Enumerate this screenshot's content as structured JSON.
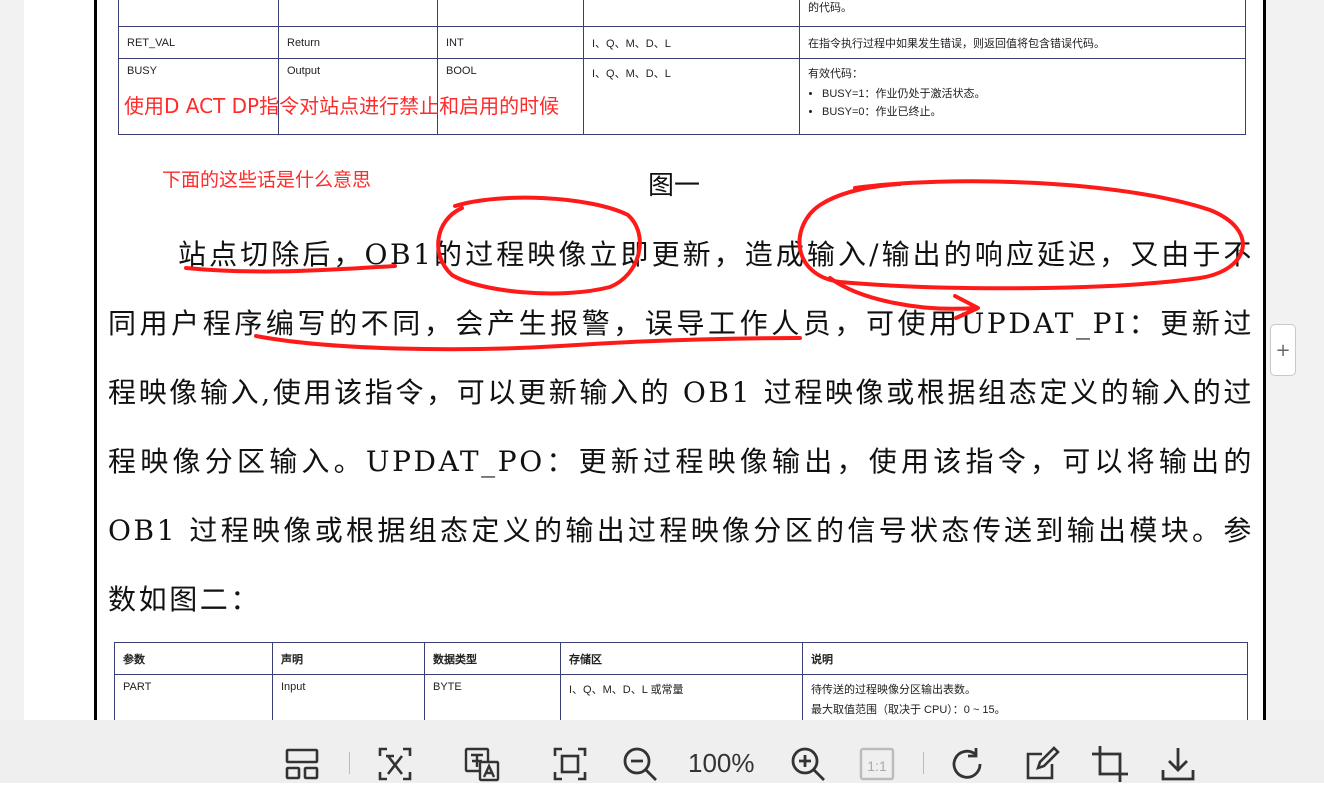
{
  "table_top": {
    "row0_desc": "的代码。",
    "rows": [
      {
        "param": "RET_VAL",
        "decl": "Return",
        "type": "INT",
        "area": "I、Q、M、D、L",
        "desc": "在指令执行过程中如果发生错误，则返回值将包含错误代码。"
      },
      {
        "param": "BUSY",
        "decl": "Output",
        "type": "BOOL",
        "area": "I、Q、M、D、L",
        "desc_title": "有效代码：",
        "desc_items": [
          "BUSY=1：作业仍处于激活状态。",
          "BUSY=0：作业已终止。"
        ]
      }
    ]
  },
  "annotations": {
    "note1": "使用D ACT DP指令对站点进行禁止和启用的时候",
    "note2": "下面的这些话是什么意思"
  },
  "figure_caption": "图一",
  "body_paragraph": "站点切除后，OB1的过程映像立即更新，造成输入/输出的响应延迟，又由于不同用户程序编写的不同，会产生报警，误导工作人员，可使用UPDAT_PI：更新过程映像输入,使用该指令，可以更新输入的 OB1 过程映像或根据组态定义的输入的过程映像分区输入。UPDAT_PO：更新过程映像输出，使用该指令，可以将输出的 OB1 过程映像或根据组态定义的输出过程映像分区的信号状态传送到输出模块。参数如图二：",
  "table_bottom": {
    "headers": [
      "参数",
      "声明",
      "数据类型",
      "存储区",
      "说明"
    ],
    "row": {
      "param": "PART",
      "decl": "Input",
      "type": "BYTE",
      "area": "I、Q、M、D、L 或常量",
      "desc1": "待传送的过程映像分区输出表数。",
      "desc2": "最大取值范围（取决于 CPU）：0 ~ 15。"
    }
  },
  "side": {
    "plus_label": "+"
  },
  "toolbar": {
    "zoom_text": "100%",
    "icons": [
      "layout-icon",
      "text-recognition-icon",
      "translate-icon",
      "fit-page-icon",
      "zoom-out-icon",
      "zoom-in-icon",
      "actual-size-icon",
      "rotate-icon",
      "edit-icon",
      "crop-icon",
      "download-icon"
    ],
    "actual_size_label": "1:1"
  },
  "colors": {
    "annotation": "#ff2a2a",
    "table_border": "#3a3f7a",
    "toolbar_bg": "#efefef"
  }
}
